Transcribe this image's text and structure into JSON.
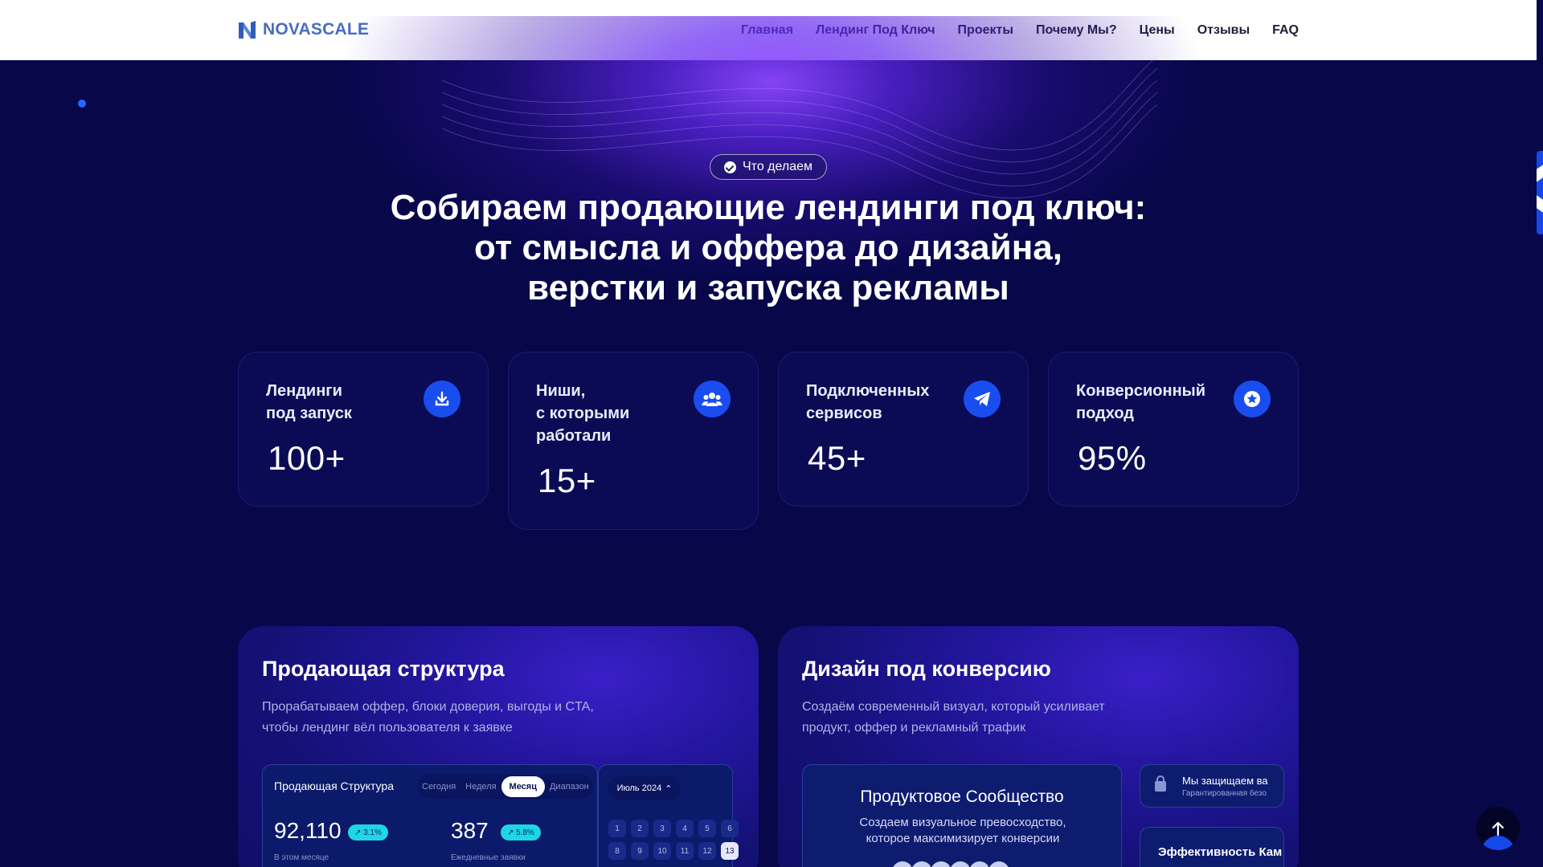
{
  "brand": {
    "name": "NOVASCALE",
    "logo_color": "#4a6cc0"
  },
  "nav": {
    "items": [
      {
        "label": "Главная"
      },
      {
        "label": "Лендинг Под Ключ"
      },
      {
        "label": "Проекты"
      },
      {
        "label": "Почему Мы?"
      },
      {
        "label": "Цены"
      },
      {
        "label": "Отзывы"
      },
      {
        "label": "FAQ"
      }
    ]
  },
  "hero": {
    "badge": "Что делаем",
    "title_lines": [
      "Собираем продающие лендинги под ключ:",
      "от смысла и оффера до дизайна,",
      "верстки и запуска рекламы"
    ]
  },
  "stats": [
    {
      "label_lines": [
        "Лендинги",
        "под запуск"
      ],
      "value": "100+",
      "icon": "download-icon"
    },
    {
      "label_lines": [
        "Ниши,",
        "с которыми",
        "работали"
      ],
      "value": "15+",
      "icon": "users-icon"
    },
    {
      "label_lines": [
        "Подключенных",
        "сервисов"
      ],
      "value": "45+",
      "icon": "telegram-icon"
    },
    {
      "label_lines": [
        "Конверсионный",
        "подход"
      ],
      "value": "95%",
      "icon": "star-icon"
    }
  ],
  "features": {
    "structure": {
      "title": "Продающая структура",
      "desc_lines": [
        "Прорабатываем оффер, блоки доверия, выгоды и CTA,",
        "чтобы лендинг вёл пользователя к заявке"
      ],
      "dashboard": {
        "title": "Продающая Структура",
        "periods": [
          "Сегодня",
          "Неделя",
          "Месяц",
          "Диапазон"
        ],
        "active_period": "Месяц",
        "metric1": {
          "value": "92,110",
          "change": "↗ 3.1%",
          "caption": "В этом месяце"
        },
        "metric2": {
          "value": "387",
          "change": "↗ 5.8%",
          "caption": "Ежедневные заявки"
        },
        "calendar_month": "Июль 2024",
        "days": [
          "1",
          "2",
          "3",
          "4",
          "5",
          "6",
          "8",
          "9",
          "10",
          "11",
          "12",
          "13"
        ]
      }
    },
    "design": {
      "title": "Дизайн под конверсию",
      "desc_lines": [
        "Создаём современный визуал, который усиливает",
        "продукт, оффер и рекламный трафик"
      ],
      "community": {
        "title": "Продуктовое Сообщество",
        "desc_lines": [
          "Создаем визуальное превосходство,",
          "которое максимизирует конверсии"
        ]
      },
      "mini1": {
        "title": "Мы защищаем ва",
        "sub": "Гарантированная безо"
      },
      "mini2": {
        "title": "Эффективность Кам"
      }
    }
  },
  "colors": {
    "background": "#07074a",
    "accent": "#1a4df0",
    "pill": "#1ed6e6"
  }
}
